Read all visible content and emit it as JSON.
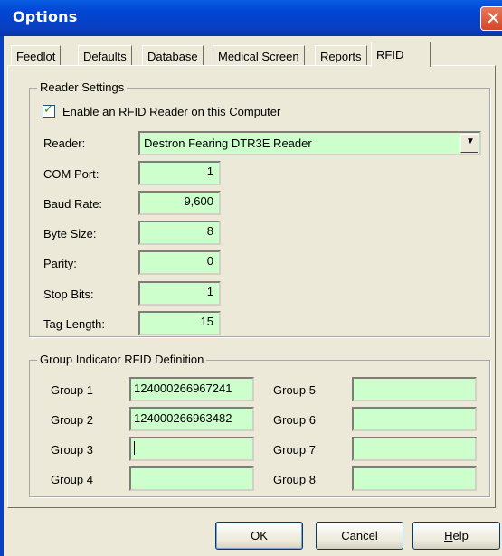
{
  "window": {
    "title": "Options",
    "close_glyph": "✕"
  },
  "tabs": [
    {
      "label": "Feedlot"
    },
    {
      "label": "Defaults"
    },
    {
      "label": "Database"
    },
    {
      "label": "Medical Screen"
    },
    {
      "label": "Reports"
    },
    {
      "label": "RFID"
    }
  ],
  "reader_settings": {
    "legend": "Reader Settings",
    "enable_checkbox": {
      "label": "Enable an RFID Reader on this Computer",
      "checked": true,
      "check_glyph": "✓"
    },
    "reader": {
      "label": "Reader:",
      "value": "Destron Fearing DTR3E Reader",
      "arrow_glyph": "▼"
    },
    "com_port": {
      "label": "COM Port:",
      "value": "1"
    },
    "baud_rate": {
      "label": "Baud Rate:",
      "value": "9,600"
    },
    "byte_size": {
      "label": "Byte Size:",
      "value": "8"
    },
    "parity": {
      "label": "Parity:",
      "value": "0"
    },
    "stop_bits": {
      "label": "Stop Bits:",
      "value": "1"
    },
    "tag_length": {
      "label": "Tag Length:",
      "value": "15"
    }
  },
  "group_definition": {
    "legend": "Group Indicator RFID Definition",
    "groups": [
      {
        "label": "Group 1",
        "value": "124000266967241"
      },
      {
        "label": "Group 2",
        "value": "124000266963482"
      },
      {
        "label": "Group 3",
        "value": ""
      },
      {
        "label": "Group 4",
        "value": ""
      },
      {
        "label": "Group 5",
        "value": ""
      },
      {
        "label": "Group 6",
        "value": ""
      },
      {
        "label": "Group 7",
        "value": ""
      },
      {
        "label": "Group 8",
        "value": ""
      }
    ]
  },
  "buttons": {
    "ok": "OK",
    "cancel": "Cancel",
    "help_first": "H",
    "help_rest": "elp"
  },
  "colors": {
    "field_bg": "#ccffcc",
    "titlebar": "#0a3fbf",
    "dialog_bg": "#ece9d8"
  }
}
